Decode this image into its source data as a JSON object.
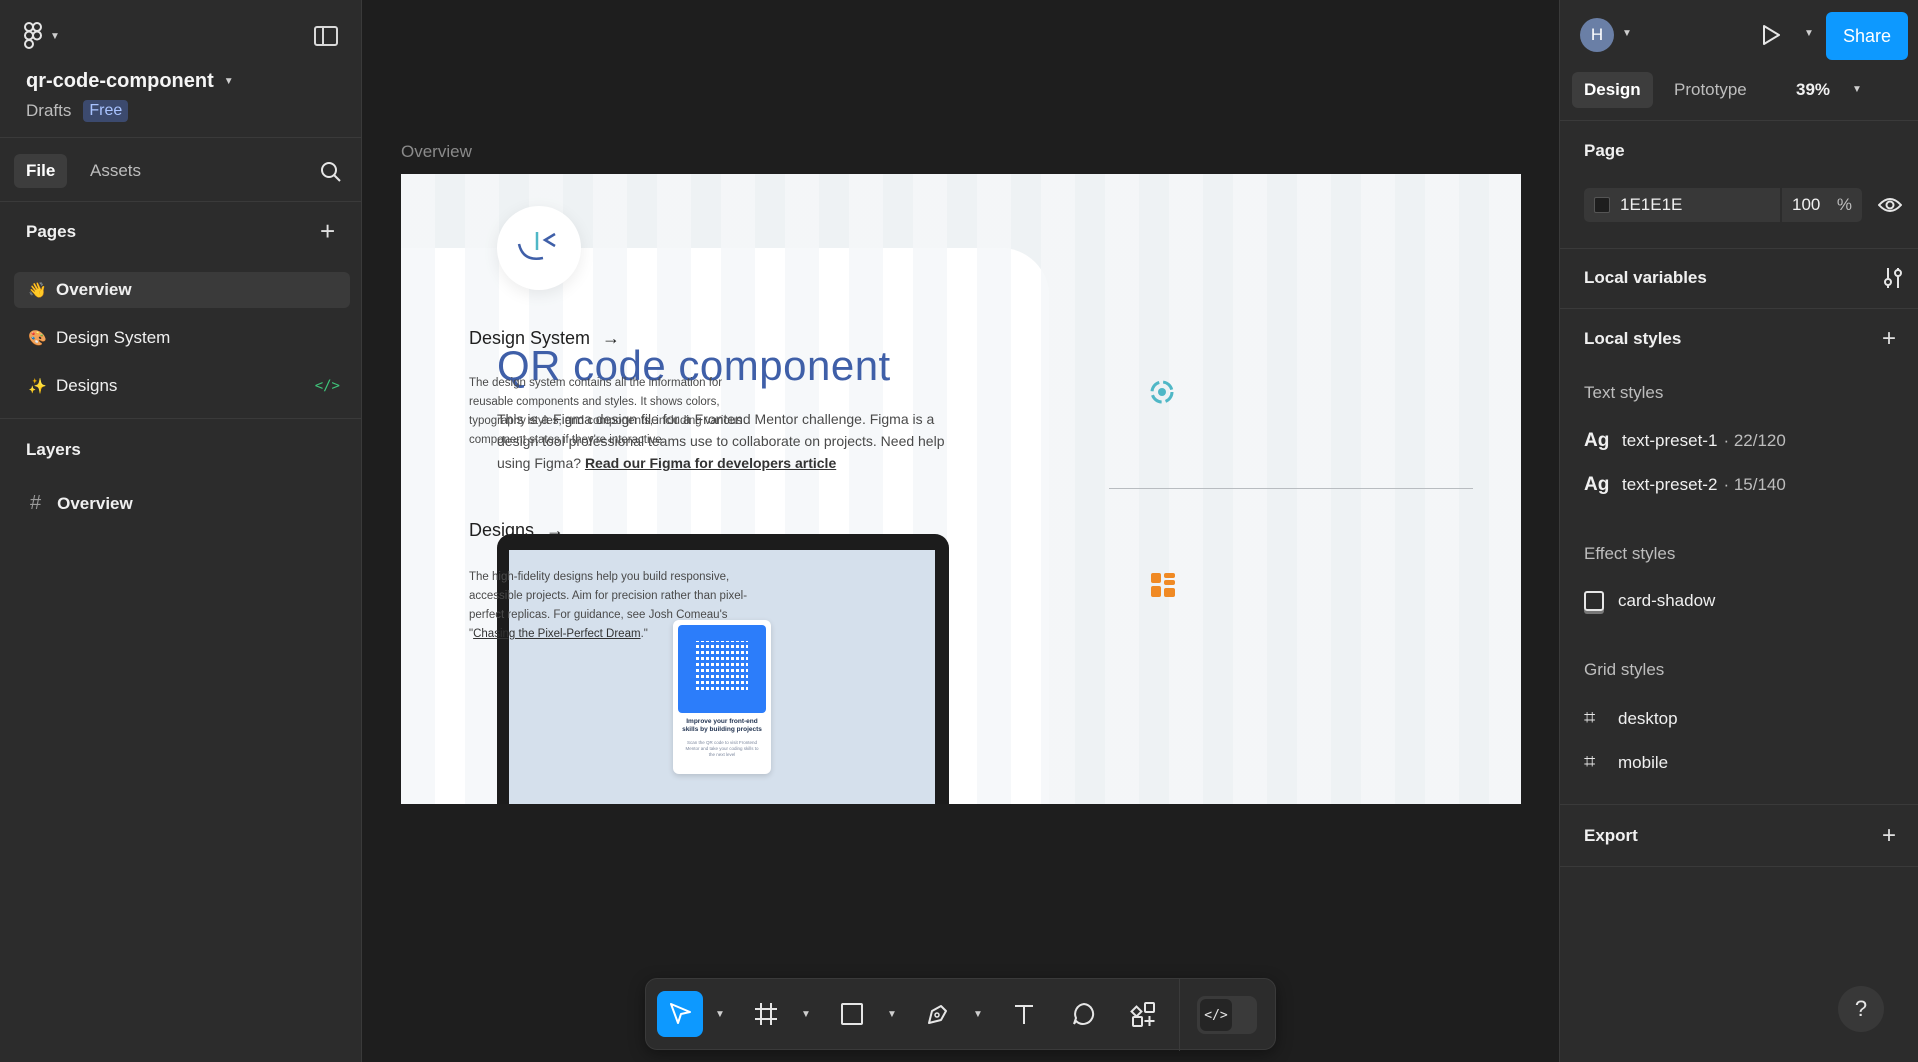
{
  "file": {
    "name": "qr-code-component",
    "location": "Drafts",
    "plan_badge": "Free"
  },
  "left_tabs": {
    "file": "File",
    "assets": "Assets"
  },
  "pages": {
    "heading": "Pages",
    "items": [
      {
        "emoji": "👋",
        "label": "Overview"
      },
      {
        "emoji": "🎨",
        "label": "Design System"
      },
      {
        "emoji": "✨",
        "label": "Designs",
        "dev_ready": "</>"
      }
    ]
  },
  "layers": {
    "heading": "Layers",
    "items": [
      {
        "label": "Overview"
      }
    ]
  },
  "canvas": {
    "frame_label": "Overview",
    "title": "QR code component",
    "description": "This is a Figma design file for a Frontend Mentor challenge. Figma is a design tool professional teams use to collaborate on projects. Need help using Figma?",
    "description_link": "Read our Figma for developers article",
    "qr_card_title": "Improve your front-end skills by building projects",
    "qr_card_text": "Scan the QR code to visit Frontend Mentor and take your coding skills to the next level",
    "design_system": {
      "title": "Design System",
      "text": "The design system contains all the information for reusable components  and styles. It shows colors, typography styles, and components,  including various component states if they're interactive."
    },
    "designs": {
      "title": "Designs",
      "text_before": "The high-fidelity designs help you build responsive, accessible  projects. Aim for precision rather than pixel-perfect replicas. For  guidance, see Josh Comeau's \"",
      "link": "Chasing the Pixel-Perfect Dream",
      "text_after": ".\""
    }
  },
  "toolbar": {
    "dev_mode": "</>"
  },
  "right_panel": {
    "avatar": "H",
    "share": "Share",
    "tabs": {
      "design": "Design",
      "prototype": "Prototype"
    },
    "zoom": "39%",
    "page": {
      "heading": "Page",
      "color": "1E1E1E",
      "opacity": "100",
      "opacity_unit": "%"
    },
    "local_variables": "Local variables",
    "local_styles": "Local styles",
    "text_styles": {
      "heading": "Text styles",
      "items": [
        {
          "icon": "Ag",
          "name": "text-preset-1",
          "detail": "· 22/120"
        },
        {
          "icon": "Ag",
          "name": "text-preset-2",
          "detail": "· 15/140"
        }
      ]
    },
    "effect_styles": {
      "heading": "Effect styles",
      "items": [
        {
          "name": "card-shadow"
        }
      ]
    },
    "grid_styles": {
      "heading": "Grid styles",
      "items": [
        {
          "name": "desktop"
        },
        {
          "name": "mobile"
        }
      ]
    },
    "export": "Export",
    "help": "?"
  },
  "colors": {
    "accent": "#0d99ff",
    "title_blue": "#3f5fa8",
    "canvas_bg": "#1e1e1e",
    "panel_bg": "#2c2c2c"
  }
}
